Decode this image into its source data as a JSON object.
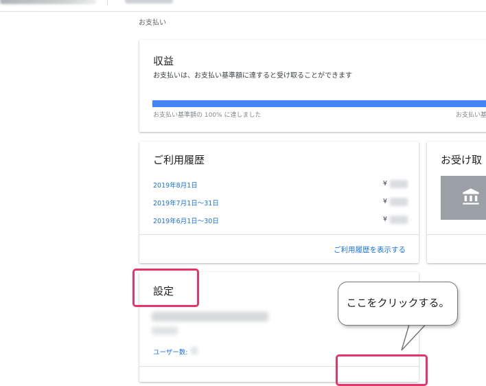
{
  "breadcrumb": "お支払い",
  "earnings": {
    "title": "収益",
    "subtitle": "お支払いは、お支払い基準額に達すると受け取ることができます",
    "progress": 1.0,
    "progress_label": "お支払い基準額の 100% に達しました",
    "right_label": "お支払い基"
  },
  "history": {
    "title": "ご利用履歴",
    "rows": [
      {
        "date": "2019年8月1日",
        "currency": "¥"
      },
      {
        "date": "2019年7月1日～31日",
        "currency": "¥"
      },
      {
        "date": "2019年6月1日～30日",
        "currency": "¥"
      }
    ],
    "view_link": "ご利用履歴を表示する"
  },
  "payment": {
    "title": "お受け取"
  },
  "settings": {
    "title": "設定",
    "users_label": "ユーザー数:"
  },
  "callout": {
    "text": "ここをクリックする。"
  },
  "colors": {
    "accent": "#4285f4",
    "link": "#1a73e8",
    "highlight": "#e8336a"
  },
  "icons": {
    "bank": "bank-icon"
  }
}
